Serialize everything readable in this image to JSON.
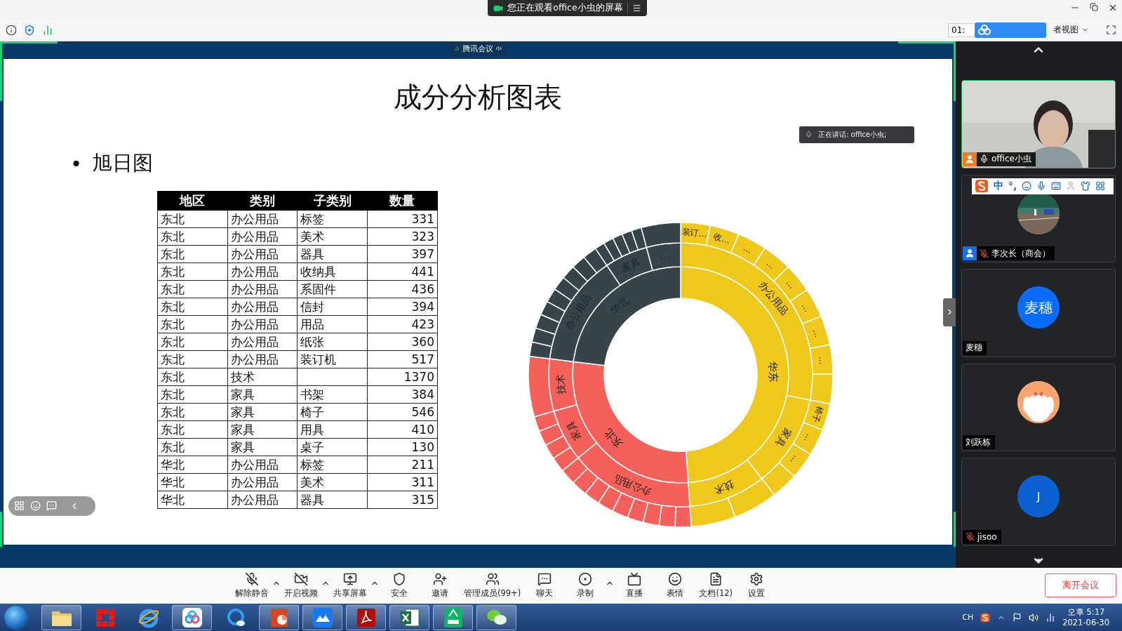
{
  "title_bar": {
    "notice": "您正在观看office小虫的屏幕"
  },
  "toolbar": {
    "timer": "01:",
    "view_label": "者视图"
  },
  "meeting_badge": "腾讯会议",
  "slide": {
    "title": "成分分析图表",
    "bullet": {
      "mark": "•",
      "text": "旭日图"
    }
  },
  "table": {
    "columns": [
      "地区",
      "类别",
      "子类别",
      "数量"
    ],
    "rows": [
      [
        "东北",
        "办公用品",
        "标签",
        "331"
      ],
      [
        "东北",
        "办公用品",
        "美术",
        "323"
      ],
      [
        "东北",
        "办公用品",
        "器具",
        "397"
      ],
      [
        "东北",
        "办公用品",
        "收纳具",
        "441"
      ],
      [
        "东北",
        "办公用品",
        "系固件",
        "436"
      ],
      [
        "东北",
        "办公用品",
        "信封",
        "394"
      ],
      [
        "东北",
        "办公用品",
        "用品",
        "423"
      ],
      [
        "东北",
        "办公用品",
        "纸张",
        "360"
      ],
      [
        "东北",
        "办公用品",
        "装订机",
        "517"
      ],
      [
        "东北",
        "技术",
        "",
        "1370"
      ],
      [
        "东北",
        "家具",
        "书架",
        "384"
      ],
      [
        "东北",
        "家具",
        "椅子",
        "546"
      ],
      [
        "东北",
        "家具",
        "用具",
        "410"
      ],
      [
        "东北",
        "家具",
        "桌子",
        "130"
      ],
      [
        "华北",
        "办公用品",
        "标签",
        "211"
      ],
      [
        "华北",
        "办公用品",
        "美术",
        "311"
      ],
      [
        "华北",
        "办公用品",
        "器具",
        "315"
      ]
    ]
  },
  "sunburst": {
    "regions": [
      {
        "label": "华东",
        "color": "#efc81b",
        "categories": [
          {
            "label": "办公用品",
            "items": [
              "装订…",
              "收…",
              "…",
              "…",
              "…",
              "…",
              "…",
              "…"
            ]
          },
          {
            "label": "家具",
            "items": [
              "椅子",
              "…",
              "…"
            ]
          },
          {
            "label": "技术"
          }
        ]
      },
      {
        "label": "东北",
        "color": "#f6605b",
        "categories": [
          {
            "label": "办公用品"
          },
          {
            "label": "家具"
          },
          {
            "label": "技术"
          }
        ]
      },
      {
        "label": "华北",
        "color": "#36454a",
        "categories": [
          {
            "label": "办公用品"
          },
          {
            "label": "家具"
          },
          {
            "label": "…"
          }
        ]
      }
    ]
  },
  "speaking": "正在讲话: office小虫;",
  "ime_bar": {
    "mode": "中",
    "punct": "°,"
  },
  "participants": [
    {
      "name": "office小虫",
      "kind": "video",
      "muted": false,
      "color": "#f07a1e",
      "active": true
    },
    {
      "name": "李次长（商会）",
      "muted": true,
      "color": "#1a6fe8",
      "active": false
    },
    {
      "name": "麦穗",
      "kind": "initials",
      "initials": "麦穗",
      "active": false
    },
    {
      "name": "刘跃栋",
      "kind": "cartoon",
      "active": false
    },
    {
      "name": "jisoo",
      "kind": "initials",
      "initials": "J",
      "muted": true,
      "active": false
    }
  ],
  "controls": [
    {
      "label": "解除静音",
      "kind": "mic-off",
      "menu": true
    },
    {
      "label": "开启视频",
      "kind": "video-off",
      "menu": true
    },
    {
      "label": "共享屏幕",
      "kind": "share",
      "menu": true
    },
    {
      "label": "安全",
      "kind": "shield",
      "menu": false
    },
    {
      "label": "邀请",
      "kind": "invite",
      "menu": false
    },
    {
      "label": "管理成员(99+)",
      "kind": "members",
      "menu": false
    },
    {
      "label": "聊天",
      "kind": "chat",
      "menu": false
    },
    {
      "label": "录制",
      "kind": "record",
      "menu": true
    },
    {
      "label": "直播",
      "kind": "live",
      "menu": false
    },
    {
      "label": "表情",
      "kind": "emoji",
      "menu": false
    },
    {
      "label": "文档(12)",
      "kind": "docs",
      "menu": false
    },
    {
      "label": "设置",
      "kind": "settings",
      "menu": false
    }
  ],
  "leave_button": "离开会议",
  "taskbar": {
    "apps": [
      {
        "kind": "folder",
        "open": true
      },
      {
        "kind": "red-app",
        "open": false
      },
      {
        "kind": "browser",
        "open": false
      },
      {
        "kind": "cloud",
        "open": true
      },
      {
        "kind": "q-browser",
        "open": false
      },
      {
        "kind": "slides",
        "open": true
      },
      {
        "kind": "meeting",
        "open": true
      },
      {
        "kind": "acrobat",
        "open": true
      },
      {
        "kind": "sheets",
        "open": true
      },
      {
        "kind": "pdf",
        "open": true
      },
      {
        "kind": "wechat",
        "open": true
      }
    ],
    "tray": {
      "lang": "CH",
      "time": "오후 5:17",
      "date": "2021-06-30"
    }
  }
}
